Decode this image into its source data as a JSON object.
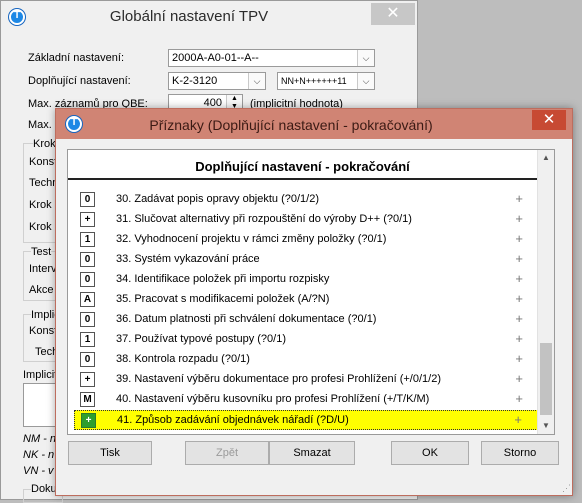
{
  "back": {
    "title": "Globální nastavení TPV",
    "basic_label": "Základní nastavení:",
    "basic_value": "2000A-A0-01--A--",
    "supp_label": "Doplňující nastavení:",
    "supp_value": "K-2-3120",
    "supp_value2": "NN+N++++++11",
    "qbe_label": "Max. záznamů pro QBE:",
    "qbe_value": "400",
    "qbe_hint": "(implicitní hodnota)",
    "max_label": "Max. z",
    "group_krok": "Krok",
    "konst": "Konst",
    "techn": "Techn",
    "krok_o": "Krok o",
    "krok_c": "Krok c",
    "group_test": "Test",
    "interv": "Interv",
    "akce": "Akce",
    "group_implic": "Implic",
    "konst2": "Konst",
    "techn2": "Tech",
    "implicitni": "Implicitn",
    "nm": "NM - n",
    "nk": "NK - n",
    "vn": "VN - v",
    "doku": "Doku"
  },
  "dialog": {
    "title": "Příznaky (Doplňující nastavení - pokračování)",
    "header": "Doplňující nastavení - pokračování",
    "items": [
      {
        "box": "0",
        "text": "30.  Zadávat popis opravy objektu (?0/1/2)",
        "mark": "+"
      },
      {
        "box": "+",
        "text": "31.  Slučovat alternativy při rozpouštění do výroby D++ (?0/1)",
        "mark": "+"
      },
      {
        "box": "1",
        "text": "32.  Vyhodnocení projektu v rámci změny položky (?0/1)",
        "mark": "+"
      },
      {
        "box": "0",
        "text": "33.  Systém vykazování práce",
        "mark": "+"
      },
      {
        "box": "0",
        "text": "34.  Identifikace položek při importu rozpisky",
        "mark": "+"
      },
      {
        "box": "A",
        "text": "35.  Pracovat s modifikacemi položek (A/?N)",
        "mark": "+"
      },
      {
        "box": "0",
        "text": "36.  Datum platnosti při schválení dokumentace (?0/1)",
        "mark": "+"
      },
      {
        "box": "1",
        "text": "37.  Používat typové postupy (?0/1)",
        "mark": "+"
      },
      {
        "box": "0",
        "text": "38.  Kontrola rozpadu (?0/1)",
        "mark": "+"
      },
      {
        "box": "+",
        "text": "39.  Nastavení výběru dokumentace pro profesi Prohlížení (+/0/1/2)",
        "mark": "+"
      },
      {
        "box": "M",
        "text": "40.  Nastavení výběru kusovníku pro profesi Prohlížení (+/T/K/M)",
        "mark": "+"
      },
      {
        "box": "+",
        "text": "41.  Způsob zadávání objednávek nářadí (?D/U)",
        "mark": "+"
      }
    ],
    "buttons": {
      "tisk": "Tisk",
      "zpet": "Zpět",
      "smazat": "Smazat",
      "ok": "OK",
      "storno": "Storno"
    }
  },
  "colors": {
    "dialog_titlebar": "#d08474",
    "close_button": "#c74a33",
    "selection": "#ffff00",
    "selected_box": "#2e9e2e"
  }
}
